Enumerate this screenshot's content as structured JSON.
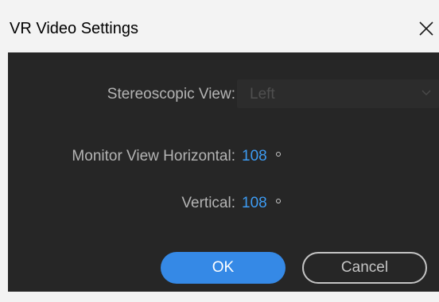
{
  "window": {
    "title": "VR Video Settings",
    "close_icon": "close-icon"
  },
  "stereoscopic": {
    "label": "Stereoscopic View:",
    "selected": "Left",
    "enabled": false,
    "icon": "chevron-down-icon"
  },
  "monitor_view": {
    "horizontal_label": "Monitor View Horizontal:",
    "horizontal_value": "108",
    "vertical_label": "Vertical:",
    "vertical_value": "108",
    "unit_icon": "degree-icon"
  },
  "buttons": {
    "ok_label": "OK",
    "cancel_label": "Cancel"
  },
  "colors": {
    "panel_bg": "#262626",
    "title_bg": "#f3f3f3",
    "accent": "#3589e6",
    "value_text": "#3d9bf2",
    "label_text": "#b4b4b4"
  }
}
